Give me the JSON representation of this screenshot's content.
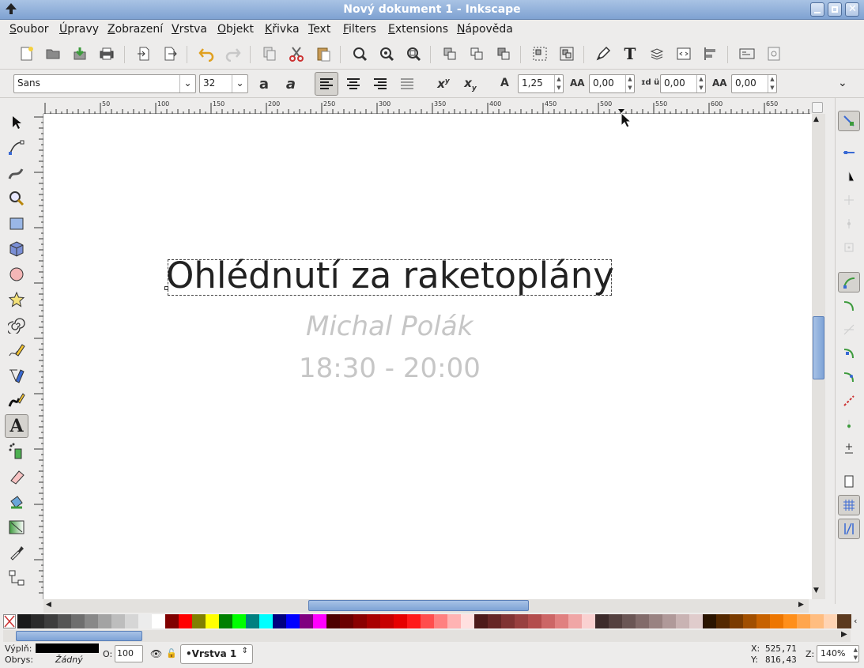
{
  "window": {
    "title": "Nový dokument 1 - Inkscape"
  },
  "menu": [
    {
      "label": "Soubor",
      "key": "S",
      "rest": "oubor"
    },
    {
      "label": "Úpravy",
      "key": "Ú",
      "rest": "pravy"
    },
    {
      "label": "Zobrazení",
      "key": "Z",
      "rest": "obrazení"
    },
    {
      "label": "Vrstva",
      "key": "V",
      "rest": "rstva"
    },
    {
      "label": "Objekt",
      "key": "O",
      "rest": "bjekt"
    },
    {
      "label": "Křivka",
      "key": "K",
      "rest": "řivka"
    },
    {
      "label": "Text",
      "key": "T",
      "rest": "ext"
    },
    {
      "label": "Filters",
      "key": "F",
      "rest": "ilters"
    },
    {
      "label": "Extensions",
      "key": "E",
      "rest": "xtensions"
    },
    {
      "label": "Nápověda",
      "key": "N",
      "rest": "ápověda"
    }
  ],
  "textToolbar": {
    "fontFamily": "Sans",
    "fontSize": "32",
    "lineSpacing": "1,25",
    "letterSpacing": "0,00",
    "wordSpacing": "0,00",
    "horizontalKern": "0,00"
  },
  "ruler": {
    "labels": [
      "50",
      "100",
      "150",
      "200",
      "250",
      "300",
      "350",
      "400",
      "450",
      "500",
      "550",
      "600",
      "650"
    ]
  },
  "document": {
    "title": "Ohlédnutí za raketoplány",
    "author": "Michal Polák",
    "time": "18:30 - 20:00",
    "titleColor": "#000000",
    "subColor": "#c6c6c6"
  },
  "status": {
    "fillLabel": "Výplň:",
    "strokeLabel": "Obrys:",
    "strokeValue": "Žádný",
    "opacityLabel": "O:",
    "opacityValue": "100",
    "layer": "•Vrstva 1",
    "xLabel": "X:",
    "xValue": "525,71",
    "yLabel": "Y:",
    "yValue": "816,43",
    "zoomLabel": "Z:",
    "zoomValue": "140%"
  },
  "palette": [
    "#1a1a1a",
    "#2b2b2b",
    "#3d3d3d",
    "#555555",
    "#6e6e6e",
    "#888888",
    "#a3a3a3",
    "#bdbdbd",
    "#d6d6d6",
    "#ececec",
    "#ffffff",
    "#800000",
    "#ff0000",
    "#808000",
    "#ffff00",
    "#008000",
    "#00ff00",
    "#008080",
    "#00ffff",
    "#000080",
    "#0000ff",
    "#800080",
    "#ff00ff",
    "#4d0000",
    "#6b0000",
    "#8a0000",
    "#a80000",
    "#c70000",
    "#e60000",
    "#ff1a1a",
    "#ff4d4d",
    "#ff8080",
    "#ffb3b3",
    "#ffe0e0",
    "#4d1a1a",
    "#662626",
    "#803333",
    "#994040",
    "#b34d4d",
    "#cc6666",
    "#e08080",
    "#f0a6a6",
    "#fad1d1",
    "#3d2b2b",
    "#54403f",
    "#6b5655",
    "#826b6a",
    "#998281",
    "#b09999",
    "#c9b3b3",
    "#e0cccc",
    "#2b1400",
    "#542800",
    "#7a3b00",
    "#a14f00",
    "#c76200",
    "#ed7600",
    "#ff8f1a",
    "#ffa64d",
    "#ffbd80",
    "#ffd4b3",
    "#5c3a1f"
  ]
}
